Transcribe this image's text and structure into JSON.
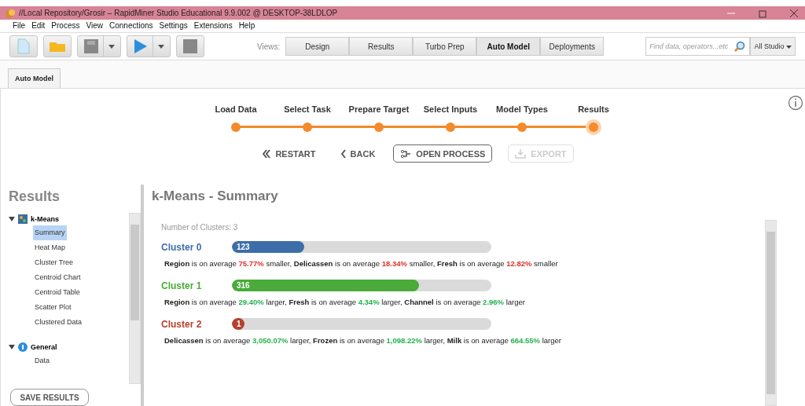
{
  "window": {
    "title": "//Local Repository/Grosir – RapidMiner Studio Educational 9.9.002 @ DESKTOP-38LDLOP"
  },
  "menu": [
    "File",
    "Edit",
    "Process",
    "View",
    "Connections",
    "Settings",
    "Extensions",
    "Help"
  ],
  "views": {
    "label": "Views:",
    "items": [
      {
        "label": "Design",
        "selected": false
      },
      {
        "label": "Results",
        "selected": false
      },
      {
        "label": "Turbo Prep",
        "selected": false
      },
      {
        "label": "Auto Model",
        "selected": true
      },
      {
        "label": "Deployments",
        "selected": false
      }
    ]
  },
  "search": {
    "placeholder": "Find data, operators...etc",
    "scope": "All Studio"
  },
  "tabs": [
    {
      "label": "Auto Model",
      "selected": true
    }
  ],
  "steps": [
    {
      "label": "Load Data",
      "selected": false
    },
    {
      "label": "Select Task",
      "selected": false
    },
    {
      "label": "Prepare Target",
      "selected": false
    },
    {
      "label": "Select Inputs",
      "selected": false
    },
    {
      "label": "Model Types",
      "selected": false
    },
    {
      "label": "Results",
      "selected": true
    }
  ],
  "actions": [
    {
      "label": "RESTART",
      "kind": "restart",
      "disabled": false
    },
    {
      "label": "BACK",
      "kind": "back",
      "disabled": false
    },
    {
      "label": "OPEN PROCESS",
      "kind": "open",
      "disabled": false
    },
    {
      "label": "EXPORT",
      "kind": "export",
      "disabled": true
    }
  ],
  "sidebar": {
    "title": "Results",
    "groups": [
      {
        "label": "k-Means",
        "kind": "model",
        "expanded": true,
        "items": [
          {
            "label": "Summary",
            "selected": true
          },
          {
            "label": "Heat Map",
            "selected": false
          },
          {
            "label": "Cluster Tree",
            "selected": false
          },
          {
            "label": "Centroid Chart",
            "selected": false
          },
          {
            "label": "Centroid Table",
            "selected": false
          },
          {
            "label": "Scatter Plot",
            "selected": false
          },
          {
            "label": "Clustered Data",
            "selected": false
          }
        ]
      },
      {
        "label": "General",
        "kind": "info",
        "expanded": true,
        "items": [
          {
            "label": "Data",
            "selected": false
          }
        ]
      }
    ],
    "save_button": "SAVE RESULTS"
  },
  "summary": {
    "title": "k-Means - Summary",
    "count_label": "Number of Clusters: 3",
    "clusters": [
      {
        "name": "Cluster 0",
        "color": "#3d6ea8",
        "count": "123",
        "level": 0.28,
        "facts": [
          {
            "attribute": "Region",
            "text": "is on average",
            "value": "75.77%",
            "color": "#e0302a",
            "trend": "smaller,"
          },
          {
            "attribute": "Delicassen",
            "text": "is on average",
            "value": "18.34%",
            "color": "#e0302a",
            "trend": "smaller,"
          },
          {
            "attribute": "Fresh",
            "text": "is on average",
            "value": "12.82%",
            "color": "#e0302a",
            "trend": "smaller"
          }
        ]
      },
      {
        "name": "Cluster 1",
        "color": "#4aaa3a",
        "count": "316",
        "level": 0.72,
        "facts": [
          {
            "attribute": "Region",
            "text": "is on average",
            "value": "29.40%",
            "color": "#22b24c",
            "trend": "larger,"
          },
          {
            "attribute": "Fresh",
            "text": "is on average",
            "value": "4.34%",
            "color": "#22b24c",
            "trend": "larger,"
          },
          {
            "attribute": "Channel",
            "text": "is on average",
            "value": "2.96%",
            "color": "#22b24c",
            "trend": "larger"
          }
        ]
      },
      {
        "name": "Cluster 2",
        "color": "#b5402e",
        "count": "1",
        "level": 0.04,
        "facts": [
          {
            "attribute": "Delicassen",
            "text": "is on average",
            "value": "3,050.07%",
            "color": "#22b24c",
            "trend": "larger,"
          },
          {
            "attribute": "Frozen",
            "text": "is on average",
            "value": "1,098.22%",
            "color": "#22b24c",
            "trend": "larger,"
          },
          {
            "attribute": "Milk",
            "text": "is on average",
            "value": "664.55%",
            "color": "#22b24c",
            "trend": "larger"
          }
        ]
      }
    ]
  }
}
